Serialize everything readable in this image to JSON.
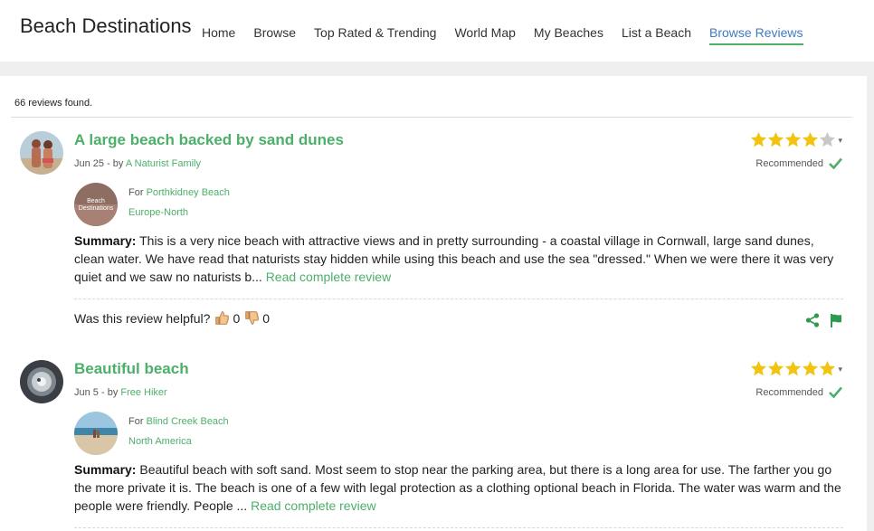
{
  "header": {
    "logo": "Beach Destinations",
    "nav": [
      {
        "label": "Home"
      },
      {
        "label": "Browse"
      },
      {
        "label": "Top Rated & Trending"
      },
      {
        "label": "World Map"
      },
      {
        "label": "My Beaches"
      },
      {
        "label": "List a Beach"
      },
      {
        "label": "Browse Reviews",
        "active": true
      }
    ]
  },
  "main": {
    "count_text": "66 reviews found.",
    "reviews": [
      {
        "title": "A large beach backed by sand dunes",
        "date": "Jun 25",
        "by": " - by ",
        "author": "A Naturist Family",
        "rating": 4,
        "rating_max": 5,
        "recommended": "Recommended",
        "for_label": "For ",
        "beach": "Porthkidney Beach",
        "region": "Europe-North",
        "thumb_logo_line1": "Beach",
        "thumb_logo_line2": "Destinations",
        "summary_label": "Summary:",
        "summary": " This is a very nice beach with attractive views and in pretty surrounding - a coastal village in Cornwall, large sand dunes, clean water. We have read that naturists stay hidden while using this beach and use the sea \"dressed.\" When we were there it was very quiet and we saw no naturists b... ",
        "read_more": "Read complete review",
        "helpful_label": "Was this review helpful? ",
        "up_count": "0",
        "down_count": "0"
      },
      {
        "title": "Beautiful beach",
        "date": "Jun 5",
        "by": " - by ",
        "author": "Free Hiker",
        "rating": 5,
        "rating_max": 5,
        "recommended": "Recommended",
        "for_label": "For ",
        "beach": "Blind Creek Beach",
        "region": "North America",
        "summary_label": "Summary:",
        "summary": " Beautiful beach with soft sand. Most seem to stop near the parking area, but there is a long area for use. The farther you go the more private it is. The beach is one of a few with legal protection as a clothing optional beach in Florida. The water was warm and the people were friendly. People ... ",
        "read_more": "Read complete review"
      }
    ]
  },
  "colors": {
    "accent_green": "#4caf6a",
    "active_nav_blue": "#3f7bbf",
    "star_gold": "#f1c40f",
    "star_empty": "#c8c8c8"
  },
  "icons": {
    "share": "share-icon",
    "flag": "flag-icon",
    "thumbs_up": "thumbs-up-icon",
    "thumbs_down": "thumbs-down-icon",
    "check": "check-icon",
    "star": "star-icon"
  }
}
